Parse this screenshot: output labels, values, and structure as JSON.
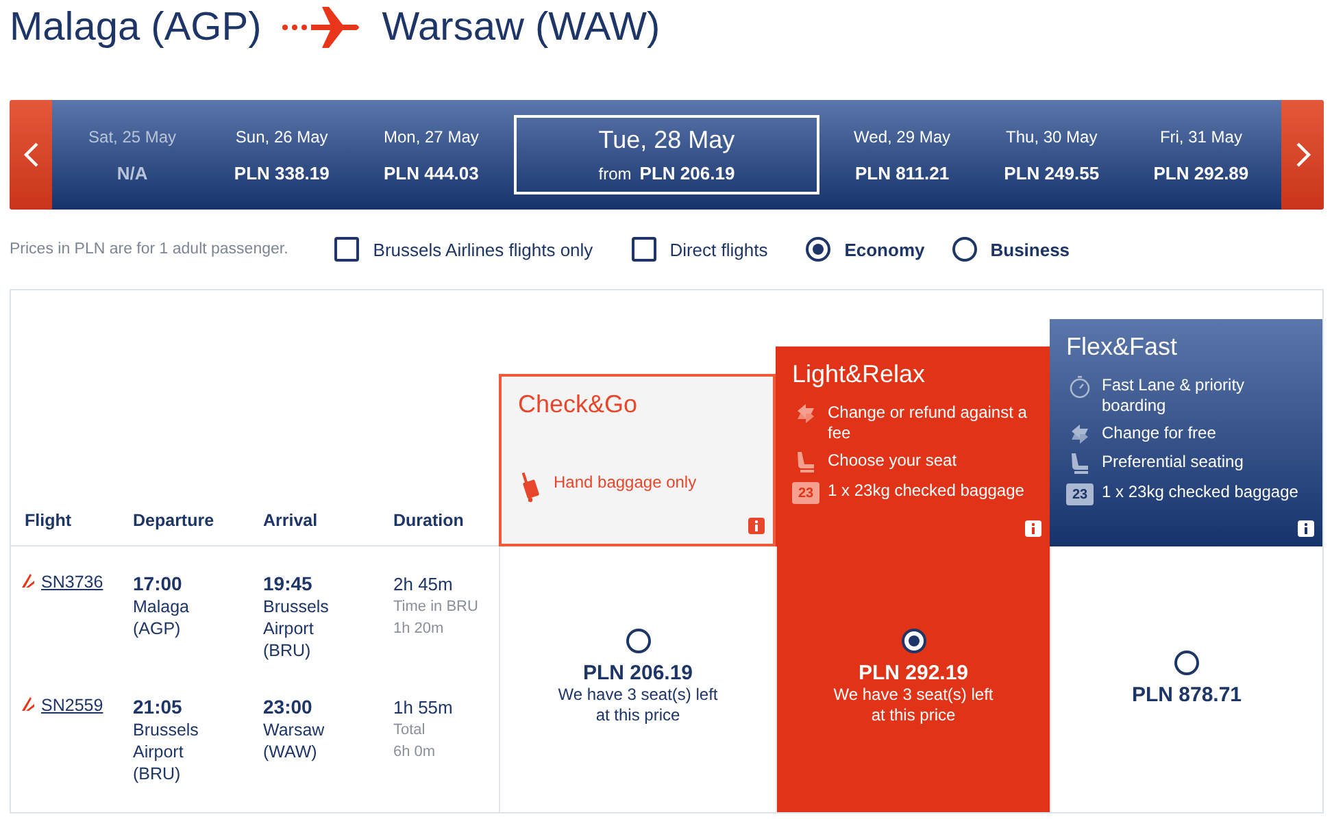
{
  "route": {
    "origin": "Malaga (AGP)",
    "destination": "Warsaw (WAW)"
  },
  "dates": [
    {
      "day": "Sat, 25 May",
      "price": "N/A",
      "disabled": true,
      "selected": false
    },
    {
      "day": "Sun, 26 May",
      "price": "PLN 338.19",
      "disabled": false,
      "selected": false
    },
    {
      "day": "Mon, 27 May",
      "price": "PLN 444.03",
      "disabled": false,
      "selected": false
    },
    {
      "day": "Tue, 28 May",
      "prefix": "from",
      "price": "PLN 206.19",
      "disabled": false,
      "selected": true
    },
    {
      "day": "Wed, 29 May",
      "price": "PLN 811.21",
      "disabled": false,
      "selected": false
    },
    {
      "day": "Thu, 30 May",
      "price": "PLN 249.55",
      "disabled": false,
      "selected": false
    },
    {
      "day": "Fri, 31 May",
      "price": "PLN 292.89",
      "disabled": false,
      "selected": false
    }
  ],
  "price_note": "Prices in PLN are for 1 adult passenger.",
  "filters": [
    {
      "kind": "checkbox",
      "label": "Brussels Airlines flights only",
      "checked": false
    },
    {
      "kind": "checkbox",
      "label": "Direct flights",
      "checked": false
    },
    {
      "kind": "radio",
      "label": "Economy",
      "checked": true
    },
    {
      "kind": "radio",
      "label": "Business",
      "checked": false
    }
  ],
  "columns": [
    "Flight",
    "Departure",
    "Arrival",
    "Duration"
  ],
  "fares": [
    {
      "name": "Check&Go",
      "kind": "outline",
      "features": [
        {
          "kind": "luggage",
          "text": "Hand baggage only"
        }
      ]
    },
    {
      "name": "Light&Relax",
      "kind": "red",
      "features": [
        {
          "kind": "swap",
          "text": "Change or refund against a fee"
        },
        {
          "kind": "seat",
          "text": "Choose your seat"
        },
        {
          "kind": "bag",
          "badge": "23",
          "text": "1 x 23kg checked baggage"
        }
      ]
    },
    {
      "name": "Flex&Fast",
      "kind": "blue",
      "features": [
        {
          "kind": "clock",
          "text": "Fast Lane & priority boarding"
        },
        {
          "kind": "swap",
          "text": "Change for free"
        },
        {
          "kind": "seat",
          "text": "Preferential seating"
        },
        {
          "kind": "bag",
          "badge": "23",
          "text": "1 x 23kg checked baggage"
        }
      ]
    }
  ],
  "segments": [
    {
      "flight": "SN3736",
      "dep_time": "17:00",
      "dep_place": "Malaga (AGP)",
      "arr_time": "19:45",
      "arr_place": "Brussels Airport (BRU)",
      "duration": "2h 45m",
      "extra_label": "Time in BRU",
      "extra_value": "1h 20m"
    },
    {
      "flight": "SN2559",
      "dep_time": "21:05",
      "dep_place": "Brussels Airport (BRU)",
      "arr_time": "23:00",
      "arr_place": "Warsaw (WAW)",
      "duration": "1h 55m",
      "extra_label": "Total",
      "extra_value": "6h 0m"
    }
  ],
  "options": [
    {
      "price": "PLN 206.19",
      "note": "We have 3 seat(s) left at this price",
      "selected": false
    },
    {
      "price": "PLN 292.19",
      "note": "We have 3 seat(s) left at this price",
      "selected": true
    },
    {
      "price": "PLN 878.71",
      "selected": false
    }
  ]
}
